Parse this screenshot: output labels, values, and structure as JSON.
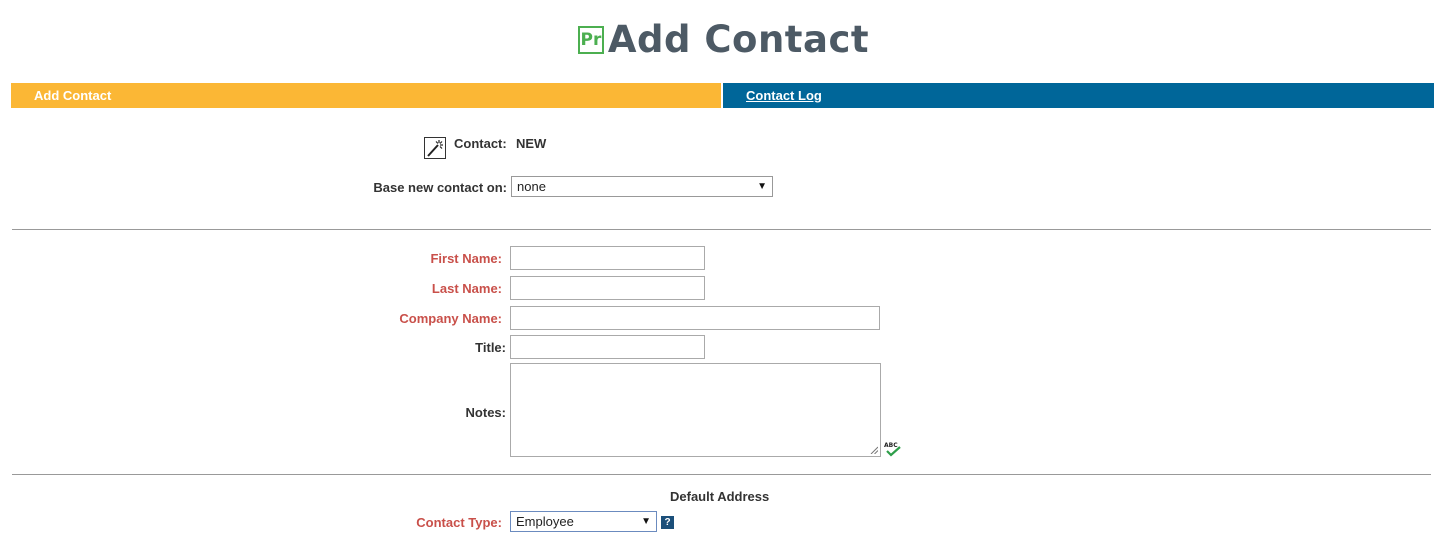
{
  "header": {
    "logo_text": "Pr",
    "title": "Add Contact"
  },
  "tabs": [
    {
      "label": "Add Contact",
      "active": true
    },
    {
      "label": "Contact Log",
      "active": false
    }
  ],
  "contact": {
    "label": "Contact:",
    "value": "NEW"
  },
  "base_contact": {
    "label": "Base new contact on:",
    "selected": "none"
  },
  "fields": {
    "first_name": {
      "label": "First Name:",
      "value": "",
      "required": true
    },
    "last_name": {
      "label": "Last Name:",
      "value": "",
      "required": true
    },
    "company_name": {
      "label": "Company Name:",
      "value": "",
      "required": true
    },
    "title": {
      "label": "Title:",
      "value": "",
      "required": false
    },
    "notes": {
      "label": "Notes:",
      "value": "",
      "required": false
    }
  },
  "address": {
    "heading": "Default Address",
    "contact_type": {
      "label": "Contact Type:",
      "selected": "Employee",
      "required": true
    }
  },
  "icons": {
    "wand": "magic-wand-icon",
    "spell": "spellcheck-icon",
    "help": "help-icon",
    "help_glyph": "?"
  },
  "colors": {
    "tab_active": "#fbb735",
    "tab_inactive": "#006699",
    "required_label": "#c9504a",
    "logo_green": "#4caf50",
    "title": "#4d5a65"
  }
}
